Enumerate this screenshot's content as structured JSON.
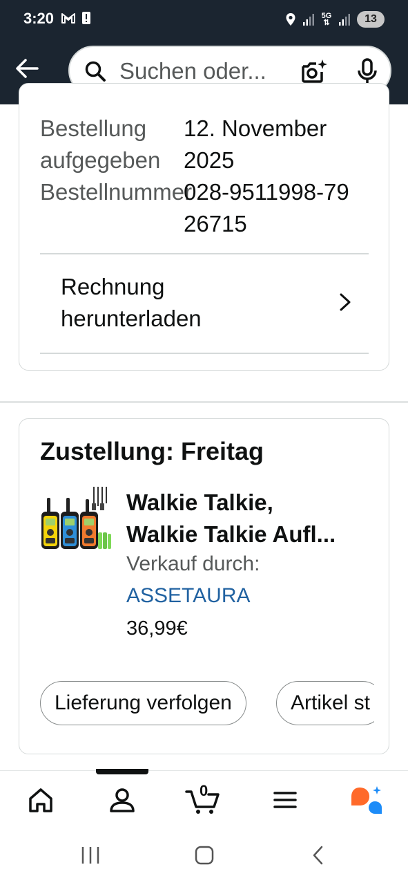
{
  "status_bar": {
    "time": "3:20",
    "network": "5G",
    "battery": "13"
  },
  "search": {
    "placeholder": "Suchen oder..."
  },
  "order": {
    "placed_label": "Bestellung aufgegeben",
    "placed_value": "12. November 2025",
    "number_label": "Bestellnummer",
    "number_value": "028-9511998-7926715",
    "invoice_label": "Rechnung herunterladen"
  },
  "delivery": {
    "title": "Zustellung: Freitag",
    "product_name_line1": "Walkie Talkie,",
    "product_name_line2": "Walkie Talkie Aufl...",
    "sold_by_label": "Verkauf durch:",
    "seller": "ASSETAURA",
    "price": "36,99€",
    "track_button": "Lieferung verfolgen",
    "second_button": "Artikel st"
  },
  "bottom_nav": {
    "cart_count": "0"
  },
  "colors": {
    "header_bg": "#1b2530",
    "link": "#2162a1",
    "assistant_orange": "#ff6a2a",
    "assistant_blue": "#1d8cf8"
  }
}
